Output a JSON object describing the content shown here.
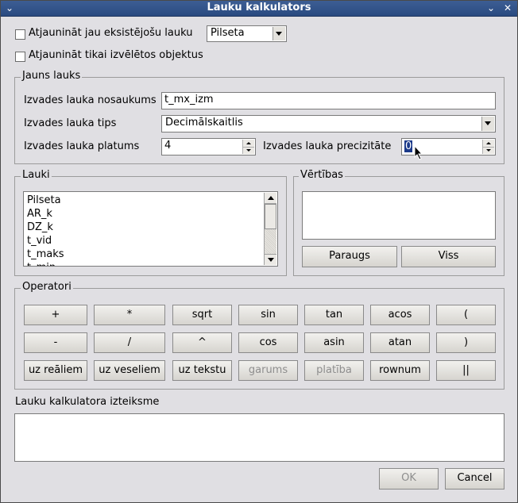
{
  "window": {
    "title": "Lauku kalkulators"
  },
  "options": {
    "update_existing_label": "Atjaunināt jau eksistējošu lauku",
    "update_field_value": "Pilseta",
    "update_selected_label": "Atjaunināt tikai izvēlētos objektus"
  },
  "new_field": {
    "group_label": "Jauns lauks",
    "name_label": "Izvades lauka nosaukums",
    "name_value": "t_mx_izm",
    "type_label": "Izvades lauka tips",
    "type_value": "Decimālskaitlis",
    "width_label": "Izvades lauka platums",
    "width_value": "4",
    "precision_label": "Izvades lauka precizitāte",
    "precision_value": "0"
  },
  "fields": {
    "group_label": "Lauki",
    "items": [
      "Pilseta",
      "AR_k",
      "DZ_k",
      "t_vid",
      "t_maks",
      "t_min"
    ]
  },
  "values": {
    "group_label": "Vērtības",
    "sample_label": "Paraugs",
    "all_label": "Viss"
  },
  "operators": {
    "group_label": "Operatori",
    "rows": [
      [
        "+",
        "*",
        "sqrt",
        "sin",
        "tan",
        "acos",
        "("
      ],
      [
        "-",
        "/",
        "^",
        "cos",
        "asin",
        "atan",
        ")"
      ],
      [
        "uz reāliem",
        "uz veseliem",
        "uz tekstu",
        "garums",
        "platība",
        "rownum",
        "||"
      ]
    ],
    "disabled": [
      "garums",
      "platība"
    ]
  },
  "expression": {
    "label": "Lauku kalkulatora izteiksme",
    "value": ""
  },
  "footer": {
    "ok_label": "OK",
    "cancel_label": "Cancel"
  }
}
